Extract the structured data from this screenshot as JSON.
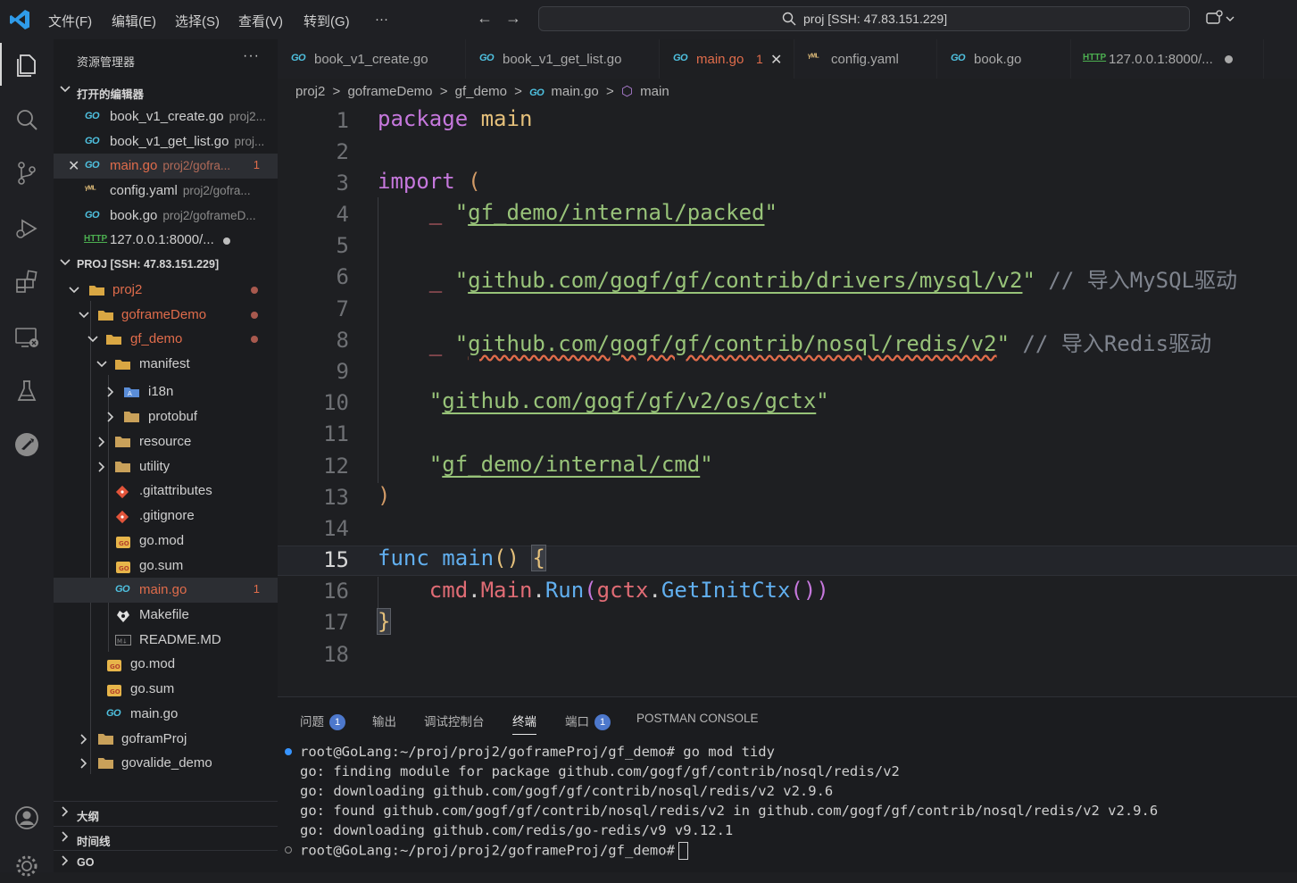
{
  "titlebar": {
    "menus": [
      "文件(F)",
      "编辑(E)",
      "选择(S)",
      "查看(V)",
      "转到(G)",
      "···"
    ],
    "command_center": "proj [SSH: 47.83.151.229]"
  },
  "sidebar": {
    "title": "资源管理器",
    "more": "···",
    "open_editors_header": "打开的编辑器",
    "open_editors": [
      {
        "name": "book_v1_create.go",
        "desc": "proj2..."
      },
      {
        "name": "book_v1_get_list.go",
        "desc": "proj..."
      },
      {
        "name": "main.go",
        "desc": "proj2/gofra...",
        "badge": "1"
      },
      {
        "name": "config.yaml",
        "desc": "proj2/gofra..."
      },
      {
        "name": "book.go",
        "desc": "proj2/goframeD..."
      },
      {
        "name": "127.0.0.1:8000/...",
        "desc": ""
      }
    ],
    "project_header": "PROJ [SSH: 47.83.151.229]",
    "tree": {
      "proj2": "proj2",
      "goframeDemo": "goframeDemo",
      "gf_demo": "gf_demo",
      "manifest": "manifest",
      "i18n": "i18n",
      "protobuf": "protobuf",
      "resource": "resource",
      "utility": "utility",
      "gitattributes": ".gitattributes",
      "gitignore": ".gitignore",
      "gomod": "go.mod",
      "gosum": "go.sum",
      "maingo": "main.go",
      "maingo_badge": "1",
      "makefile": "Makefile",
      "readme": "README.MD",
      "gomod2": "go.mod",
      "gosum2": "go.sum",
      "maingo2": "main.go",
      "goframProj": "goframProj",
      "govalide_demo": "govalide_demo"
    },
    "outline_header": "大纲",
    "timeline_header": "时间线",
    "go_header": "GO"
  },
  "tabs": [
    {
      "label": "book_v1_create.go"
    },
    {
      "label": "book_v1_get_list.go"
    },
    {
      "label": "main.go",
      "count": "1"
    },
    {
      "label": "config.yaml"
    },
    {
      "label": "book.go"
    },
    {
      "label": "127.0.0.1:8000/..."
    }
  ],
  "breadcrumbs": [
    "proj2",
    ">",
    "goframeDemo",
    ">",
    "gf_demo",
    ">",
    "main.go",
    ">",
    "main"
  ],
  "editor": {
    "line_numbers": [
      "1",
      "2",
      "3",
      "4",
      "5",
      "6",
      "7",
      "8",
      "9",
      "10",
      "11",
      "12",
      "13",
      "14",
      "15",
      "16",
      "17",
      "18"
    ],
    "current_line": "15",
    "tokens": {
      "package": "package",
      "main": "main",
      "import": "import",
      "lparen": "(",
      "rparen": ")",
      "blank": "_",
      "quote": "\"",
      "imp1": "gf_demo/internal/packed",
      "imp2": "github.com/gogf/gf/contrib/drivers/mysql/v2",
      "c2": "// 导入MySQL驱动",
      "imp3": "github.com/gogf/gf/contrib/nosql/redis/v2",
      "c3": "// 导入Redis驱动",
      "imp4": "github.com/gogf/gf/v2/os/gctx",
      "imp5": "gf_demo/internal/cmd",
      "func": "func",
      "fname": "main",
      "parens": "()",
      "lbrace": "{",
      "rbrace": "}",
      "cmd": "cmd",
      "dot": ".",
      "Main": "Main",
      "Run": "Run",
      "gctx": "gctx",
      "GetInitCtx": "GetInitCtx",
      "call_close": "())"
    }
  },
  "panel": {
    "tabs": [
      {
        "label": "问题",
        "badge": "1"
      },
      {
        "label": "输出"
      },
      {
        "label": "调试控制台"
      },
      {
        "label": "终端"
      },
      {
        "label": "端口",
        "badge": "1"
      },
      {
        "label": "POSTMAN CONSOLE"
      }
    ],
    "terminal_lines": [
      "root@GoLang:~/proj/proj2/goframeProj/gf_demo# go mod tidy",
      "go: finding module for package github.com/gogf/gf/contrib/nosql/redis/v2",
      "go: downloading github.com/gogf/gf/contrib/nosql/redis/v2 v2.9.6",
      "go: found github.com/gogf/gf/contrib/nosql/redis/v2 in github.com/gogf/gf/contrib/nosql/redis/v2 v2.9.6",
      "go: downloading github.com/redis/go-redis/v9 v9.12.1",
      "root@GoLang:~/proj/proj2/goframeProj/gf_demo#"
    ]
  }
}
